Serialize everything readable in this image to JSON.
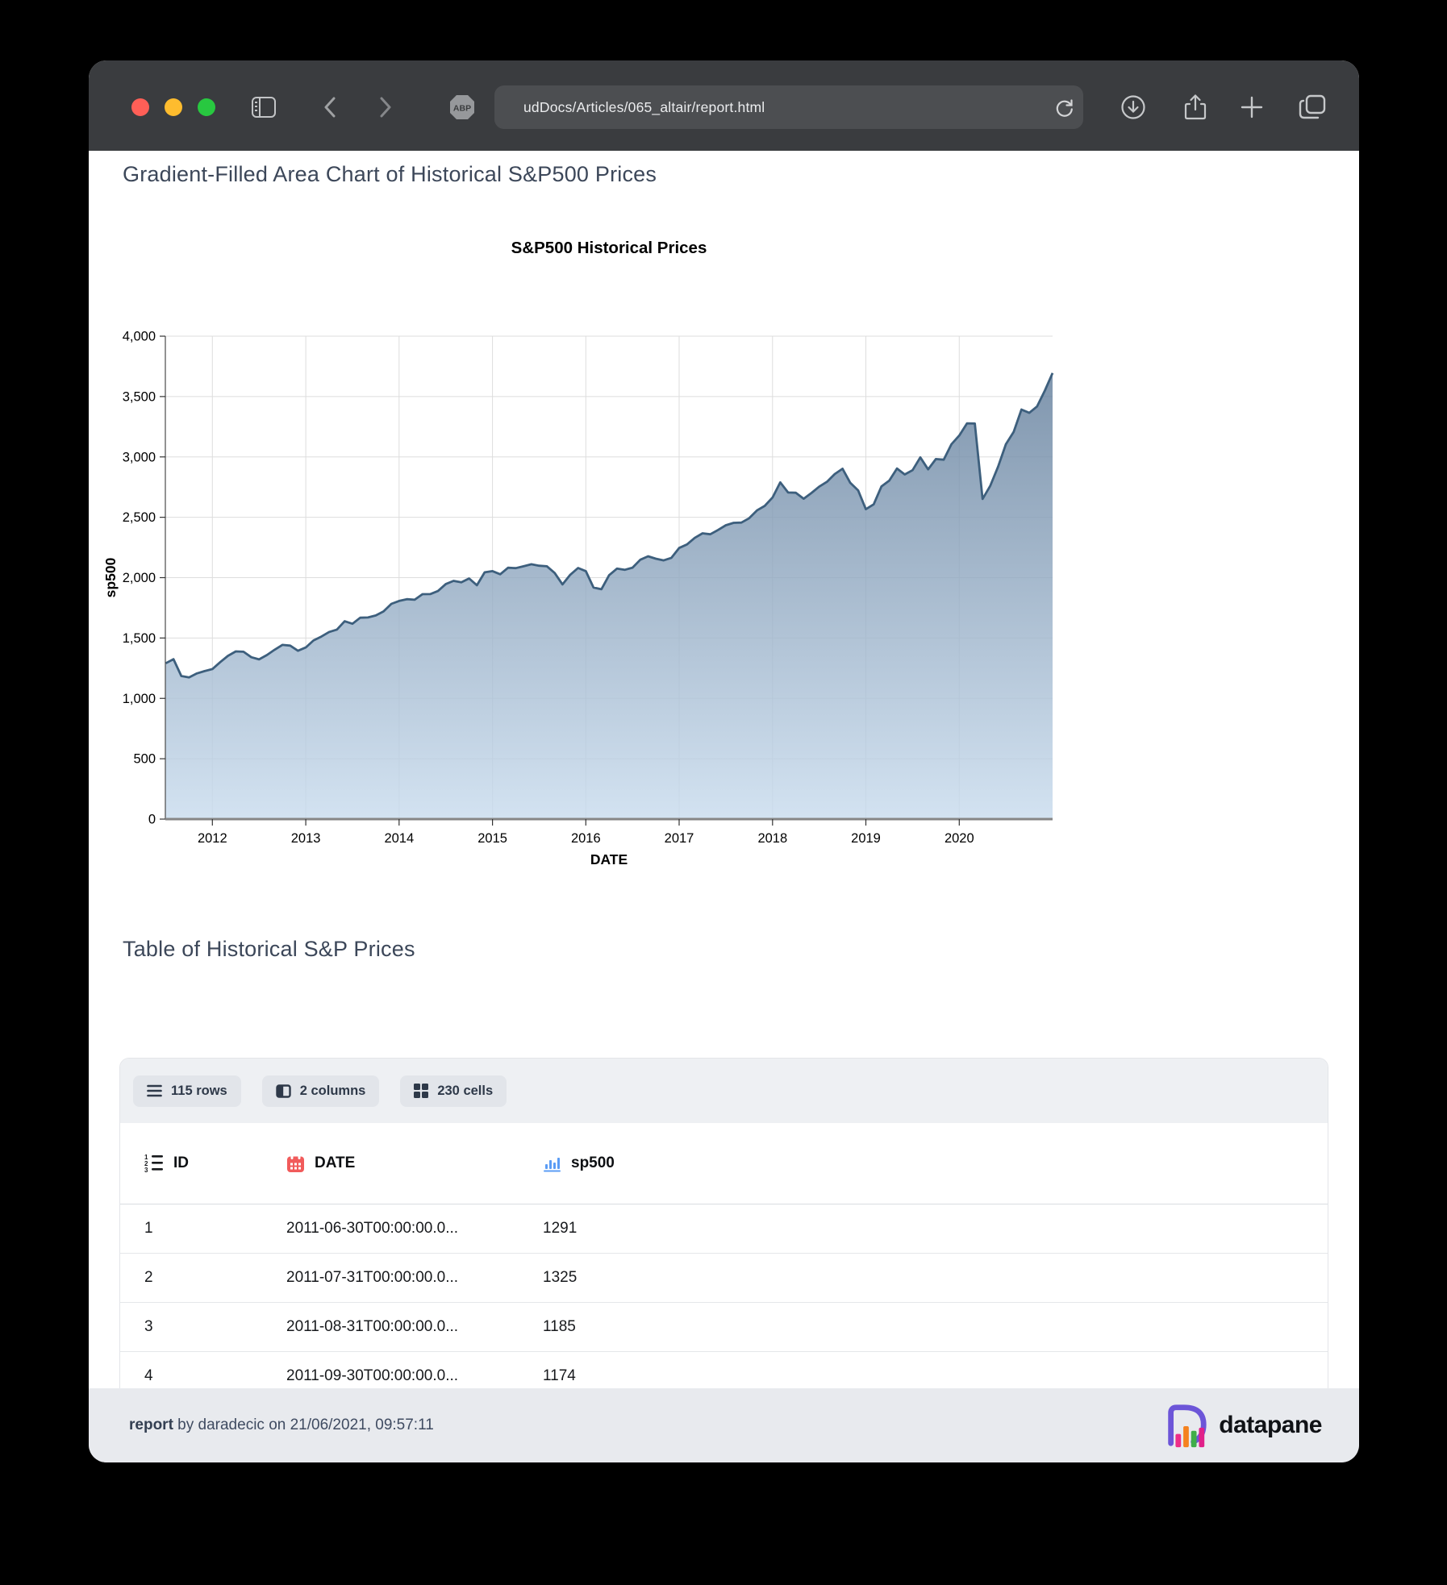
{
  "browser": {
    "url": "udDocs/Articles/065_altair/report.html",
    "window_controls": [
      "close",
      "minimize",
      "zoom"
    ],
    "toolbar_icons": [
      "sidebar",
      "back",
      "forward",
      "adblock-abp",
      "grammarly-g",
      "shield",
      "reload",
      "download",
      "share",
      "new-tab",
      "tab-overview"
    ]
  },
  "page": {
    "chart_section_title": "Gradient-Filled Area Chart of Historical S&P500 Prices",
    "table_section_title": "Table of Historical S&P Prices"
  },
  "chart_data": {
    "type": "area",
    "title": "S&P500 Historical Prices",
    "xlabel": "DATE",
    "ylabel": "sp500",
    "x_start": "2011-06-30",
    "x_freq": "monthly",
    "x_tick_labels": [
      "2012",
      "2013",
      "2014",
      "2015",
      "2016",
      "2017",
      "2018",
      "2019",
      "2020"
    ],
    "y_tick_labels": [
      "0",
      "500",
      "1,000",
      "1,500",
      "2,000",
      "2,500",
      "3,000",
      "3,500",
      "4,000"
    ],
    "ylim": [
      0,
      4000
    ],
    "grid": true,
    "line_color": "#3d5f7d",
    "gradient_top": "#647f9c",
    "gradient_bottom": "#c9dcee",
    "values": [
      1291,
      1325,
      1185,
      1174,
      1207,
      1226,
      1243,
      1300,
      1352,
      1389,
      1386,
      1341,
      1323,
      1359,
      1403,
      1443,
      1437,
      1394,
      1422,
      1480,
      1512,
      1550,
      1570,
      1639,
      1618,
      1668,
      1670,
      1687,
      1720,
      1783,
      1807,
      1822,
      1817,
      1863,
      1864,
      1889,
      1947,
      1973,
      1961,
      1993,
      1937,
      2044,
      2054,
      2028,
      2082,
      2079,
      2094,
      2111,
      2099,
      2094,
      2039,
      1944,
      2024,
      2080,
      2054,
      1918,
      1904,
      2021,
      2075,
      2065,
      2083,
      2148,
      2177,
      2157,
      2143,
      2164,
      2246,
      2275,
      2329,
      2367,
      2359,
      2395,
      2434,
      2454,
      2456,
      2492,
      2557,
      2594,
      2664,
      2789,
      2705,
      2703,
      2654,
      2701,
      2754,
      2794,
      2858,
      2902,
      2785,
      2723,
      2567,
      2607,
      2755,
      2804,
      2904,
      2855,
      2890,
      2996,
      2897,
      2982,
      2977,
      3105,
      3177,
      3278,
      3277,
      2652,
      2762,
      2920,
      3105,
      3208,
      3392,
      3365,
      3418,
      3549,
      3695
    ]
  },
  "table": {
    "badges": [
      {
        "icon": "rows-icon",
        "label": "115 rows"
      },
      {
        "icon": "columns-icon",
        "label": "2 columns"
      },
      {
        "icon": "cells-icon",
        "label": "230 cells"
      }
    ],
    "columns": [
      {
        "icon": "numbered-list-icon",
        "label": "ID"
      },
      {
        "icon": "calendar-icon",
        "label": "DATE"
      },
      {
        "icon": "bar-chart-icon",
        "label": "sp500"
      }
    ],
    "rows": [
      [
        "1",
        "2011-06-30T00:00:00.0...",
        "1291"
      ],
      [
        "2",
        "2011-07-31T00:00:00.0...",
        "1325"
      ],
      [
        "3",
        "2011-08-31T00:00:00.0...",
        "1185"
      ],
      [
        "4",
        "2011-09-30T00:00:00.0...",
        "1174"
      ]
    ]
  },
  "footer": {
    "report_label": "report",
    "credit_rest": " by daradecic on 21/06/2021, 09:57:11",
    "brand": "datapane",
    "brand_purple": "#6c55d8"
  }
}
